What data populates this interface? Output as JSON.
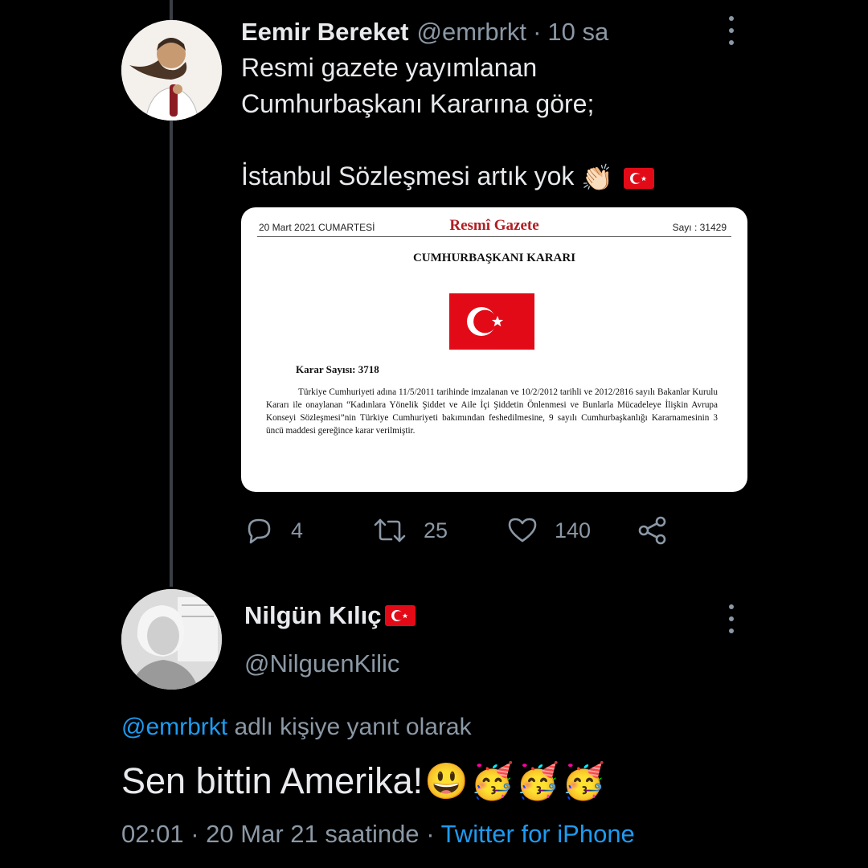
{
  "tweet": {
    "name": "Eemir Bereket",
    "handle": "@emrbrkt",
    "separator": "·",
    "time": "10 sa",
    "text_lines": [
      "Resmi gazete yayımlanan",
      "Cumhurbaşkanı Kararına göre;",
      "",
      "İstanbul Sözleşmesi artık yok"
    ],
    "text_emoji": "👏🏻",
    "counts": {
      "reply": "4",
      "retweet": "25",
      "like": "140"
    }
  },
  "gazette": {
    "date": "20 Mart 2021 CUMARTESİ",
    "title": "Resmî Gazete",
    "issue": "Sayı : 31429",
    "heading": "CUMHURBAŞKANI KARARI",
    "decision_number": "Karar Sayısı: 3718",
    "body": "Türkiye Cumhuriyeti adına 11/5/2011 tarihinde imzalanan ve 10/2/2012 tarihli ve 2012/2816 sayılı Bakanlar Kurulu Kararı ile onaylanan “Kadınlara Yönelik Şiddet ve Aile İçi Şiddetin Önlenmesi ve Bunlarla Mücadeleye İlişkin Avrupa Konseyi Sözleşmesi”nin Türkiye Cumhuriyeti bakımından feshedilmesine, 9 sayılı Cumhurbaşkanlığı Kararnamesinin 3 üncü maddesi gereğince karar verilmiştir."
  },
  "reply": {
    "name": "Nilgün Kılıç",
    "handle": "@NilguenKilic",
    "reply_mention": "@emrbrkt",
    "reply_suffix": " adlı kişiye yanıt olarak",
    "text": "Sen bittin Amerika!",
    "emojis": [
      "😃",
      "🥳",
      "🥳",
      "🥳"
    ],
    "time": "02:01",
    "separator": "·",
    "date": "20 Mar 21 saatinde",
    "source": "Twitter for iPhone"
  },
  "colors": {
    "background": "#000000",
    "secondary_text": "#8b98a5",
    "link": "#1d9bf0",
    "flag_red": "#e30a17"
  }
}
